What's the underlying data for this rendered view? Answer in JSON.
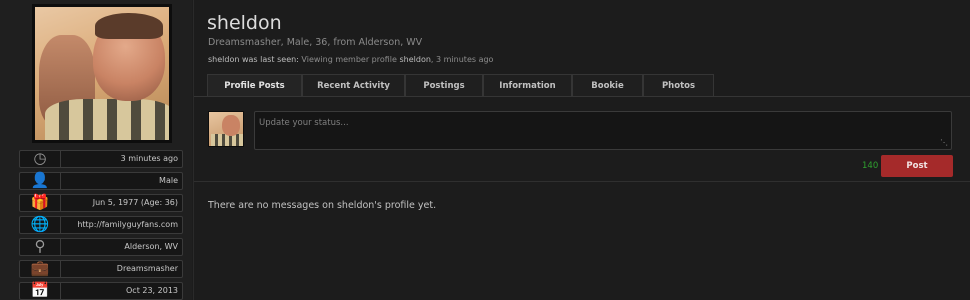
{
  "profile": {
    "name": "sheldon",
    "subtitle": "Dreamsmasher, Male, 36, from Alderson, WV",
    "last_seen_prefix": "sheldon was last seen:",
    "last_seen_text": "Viewing member profile",
    "last_seen_user": "sheldon",
    "last_seen_time": "3 minutes ago"
  },
  "sidebar": {
    "items": [
      {
        "icon": "clock-icon",
        "value": "3 minutes ago"
      },
      {
        "icon": "user-icon",
        "value": "Male"
      },
      {
        "icon": "gift-icon",
        "value": "Jun 5, 1977 (Age: 36)"
      },
      {
        "icon": "globe-icon",
        "value": "http://familyguyfans.com"
      },
      {
        "icon": "location-pin-icon",
        "value": "Alderson, WV"
      },
      {
        "icon": "briefcase-icon",
        "value": "Dreamsmasher"
      },
      {
        "icon": "calendar-icon",
        "value": "Oct 23, 2013"
      }
    ]
  },
  "tabs": [
    {
      "label": "Profile Posts",
      "active": true
    },
    {
      "label": "Recent Activity",
      "active": false
    },
    {
      "label": "Postings",
      "active": false
    },
    {
      "label": "Information",
      "active": false
    },
    {
      "label": "Bookie",
      "active": false
    },
    {
      "label": "Photos",
      "active": false
    }
  ],
  "status": {
    "placeholder": "Update your status...",
    "char_counter": "140",
    "post_label": "Post"
  },
  "messages": {
    "empty_text": "There are no messages on sheldon's profile yet."
  },
  "colors": {
    "background": "#1c1c1c",
    "post_button": "#a52a2a",
    "counter": "#2fa12f"
  }
}
